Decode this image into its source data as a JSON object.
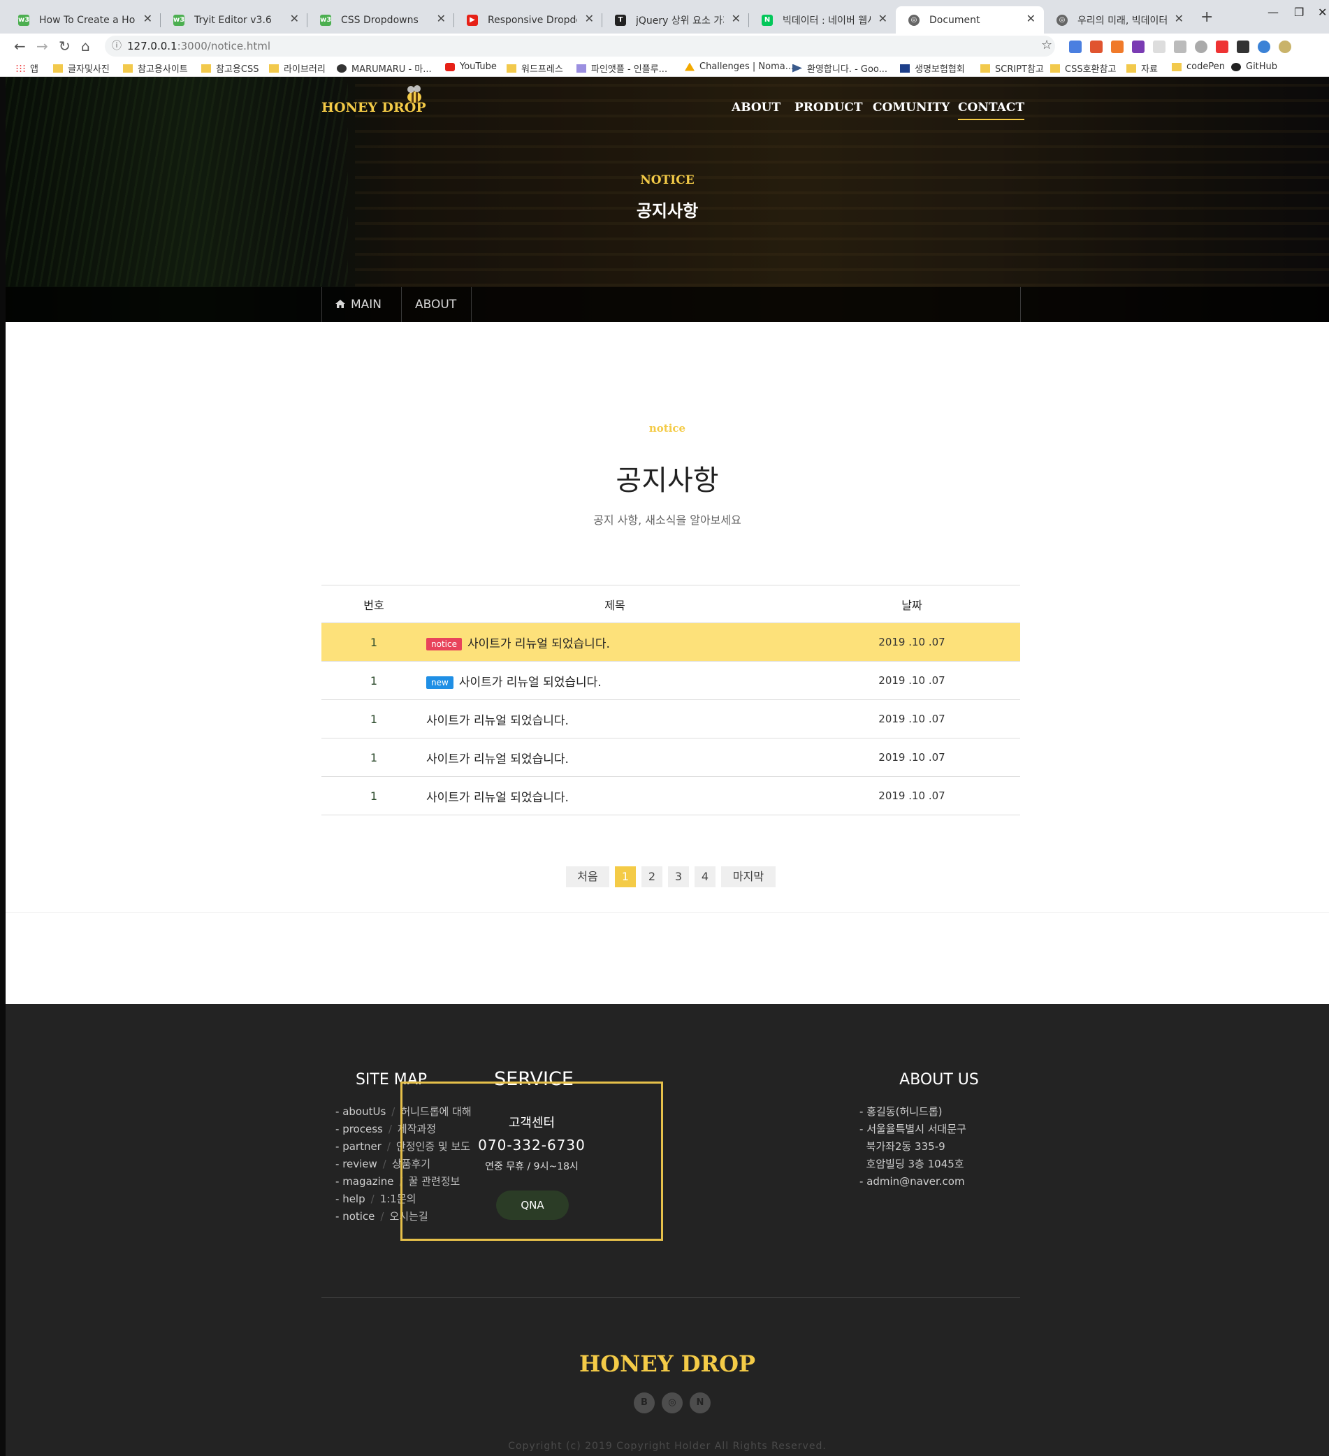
{
  "browser": {
    "tabs": [
      {
        "title": "How To Create a Horizont",
        "favicon": "w3schools-icon"
      },
      {
        "title": "Tryit Editor v3.6",
        "favicon": "w3schools-icon"
      },
      {
        "title": "CSS Dropdowns",
        "favicon": "w3schools-icon"
      },
      {
        "title": "Responsive Dropdown Na",
        "favicon": "youtube-icon"
      },
      {
        "title": "jQuery 상위 요소 가져오기",
        "favicon": "tistory-icon"
      },
      {
        "title": "빅데이터 : 네이버 웹사이트",
        "favicon": "naver-icon"
      },
      {
        "title": "Document",
        "favicon": "globe-icon",
        "active": true
      },
      {
        "title": "우리의 미래, 빅데이터 - 핑",
        "favicon": "globe-icon"
      }
    ],
    "url_host": "127.0.0.1",
    "url_rest": ":3000/notice.html",
    "bookmarks": [
      "앱",
      "글자및사진",
      "참고용사이트",
      "참고용CSS",
      "라이브러리",
      "MARUMARU - 마...",
      "YouTube",
      "워드프레스",
      "파인앳플 - 인플루...",
      "Challenges | Noma...",
      "환영합니다. - Goo...",
      "생명보험협회",
      "SCRIPT참고",
      "CSS호환참고",
      "자료",
      "codePen",
      "GitHub"
    ]
  },
  "header": {
    "logo": "HONEY DROP",
    "nav": [
      "ABOUT",
      "PRODUCT",
      "COMUNITY",
      "CONTACT"
    ],
    "active_nav": "CONTACT",
    "hero_sub": "NOTICE",
    "hero_title": "공지사항",
    "lnb": [
      "MAIN",
      "ABOUT"
    ]
  },
  "notice": {
    "eyebrow": "notice",
    "title": "공지사항",
    "desc": "공지 사항, 새소식을 알아보세요",
    "columns": [
      "번호",
      "제목",
      "날짜"
    ],
    "rows": [
      {
        "no": "1",
        "badge": "notice",
        "badge_color": "#e8435b",
        "title": "사이트가 리뉴얼 되었습니다.",
        "date": "2019 .10 .07",
        "highlight": true
      },
      {
        "no": "1",
        "badge": "new",
        "badge_color": "#1f8fe5",
        "title": "사이트가 리뉴얼 되었습니다.",
        "date": "2019 .10 .07"
      },
      {
        "no": "1",
        "badge": "",
        "title": "사이트가 리뉴얼 되었습니다.",
        "date": "2019 .10 .07"
      },
      {
        "no": "1",
        "badge": "",
        "title": "사이트가 리뉴얼 되었습니다.",
        "date": "2019 .10 .07"
      },
      {
        "no": "1",
        "badge": "",
        "title": "사이트가 리뉴얼 되었습니다.",
        "date": "2019 .10 .07"
      }
    ],
    "pager": {
      "first": "처음",
      "pages": [
        "1",
        "2",
        "3",
        "4"
      ],
      "current": "1",
      "last": "마지막"
    }
  },
  "footer": {
    "sitemap_title": "SITE MAP",
    "sitemap": [
      {
        "en": "aboutUs",
        "kr": "허니드롭에 대해"
      },
      {
        "en": "process",
        "kr": "제작과정"
      },
      {
        "en": "partner",
        "kr": "안정인증 및 보도"
      },
      {
        "en": "review",
        "kr": "상품후기"
      },
      {
        "en": "magazine",
        "kr": "꿀 관련정보"
      },
      {
        "en": "help",
        "kr": "1:1문의"
      },
      {
        "en": "notice",
        "kr": "오시는길"
      }
    ],
    "service_title": "SERVICE",
    "service_center": "고객센터",
    "service_phone": "070-332-6730",
    "service_hours": "연중 무휴 / 9시~18시",
    "qna_label": "QNA",
    "about_title": "ABOUT US",
    "about": [
      "홍길동(허니드롭)",
      "서울율특별시 서대문구",
      "북가좌2동 335-9",
      "호암빌딩 3층 1045호",
      "admin@naver.com"
    ],
    "logo": "HONEY DROP",
    "social": [
      "blog-icon",
      "instagram-icon",
      "naver-icon"
    ],
    "copyright": "Copyright (c) 2019 Copyright Holder All Rights Reserved."
  },
  "colors": {
    "accent": "#f4cb47",
    "highlight_row": "#fde17a",
    "footer_bg": "#232323"
  }
}
